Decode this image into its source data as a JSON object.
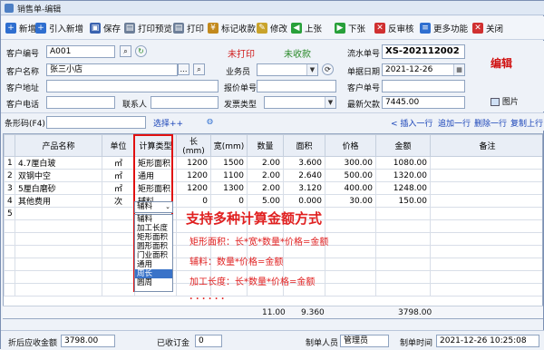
{
  "window": {
    "title": "销售单-编辑"
  },
  "toolbar": [
    {
      "name": "new-button",
      "label": "新增",
      "icon": "plus-icon",
      "color": "#2f6fd0",
      "glyph": "+"
    },
    {
      "name": "import-new-button",
      "label": "引入新增",
      "icon": "import-icon",
      "color": "#2f6fd0",
      "glyph": "+"
    },
    {
      "name": "save-button",
      "label": "保存",
      "icon": "floppy-icon",
      "color": "#3a63b0",
      "glyph": "▣"
    },
    {
      "name": "print-preview-button",
      "label": "打印预览",
      "icon": "print-preview-icon",
      "color": "#6d7f99",
      "glyph": "▤"
    },
    {
      "name": "print-button",
      "label": "打印",
      "icon": "printer-icon",
      "color": "#6d7f99",
      "glyph": "▤"
    },
    {
      "name": "mark-received-button",
      "label": "标记收款",
      "icon": "money-icon",
      "color": "#c38a1d",
      "glyph": "¥"
    },
    {
      "name": "modify-button",
      "label": "修改",
      "icon": "pencil-icon",
      "color": "#c9a32b",
      "glyph": "✎"
    },
    {
      "name": "prev-button",
      "label": "上张",
      "icon": "arrow-left-icon",
      "color": "#28a03a",
      "glyph": "◀"
    },
    {
      "name": "next-button",
      "label": "下张",
      "icon": "arrow-right-icon",
      "color": "#28a03a",
      "glyph": "▶"
    },
    {
      "name": "unaudit-button",
      "label": "反审核",
      "icon": "unaudit-icon",
      "color": "#d03030",
      "glyph": "✕"
    },
    {
      "name": "more-button",
      "label": "更多功能",
      "icon": "more-icon",
      "color": "#2f6fd0",
      "glyph": "≡"
    },
    {
      "name": "close-button",
      "label": "关闭",
      "icon": "close-icon",
      "color": "#d03030",
      "glyph": "✕"
    }
  ],
  "form": {
    "customer_code_label": "客户编号",
    "customer_code": "A001",
    "customer_name_label": "客户名称",
    "customer_name": "张三小店",
    "customer_addr_label": "客户地址",
    "customer_addr": "",
    "customer_phone_label": "客户电话",
    "customer_phone": "",
    "contact_label": "联系人",
    "contact": "",
    "print_status": "未打印",
    "receive_status": "未收款",
    "salesperson_label": "业务员",
    "salesperson": "",
    "quote_no_label": "报价单号",
    "quote_no": "",
    "invoice_type_label": "发票类型",
    "invoice_type": "",
    "serial_label": "流水单号",
    "serial": "XS-202112002",
    "date_label": "单据日期",
    "date": "2021-12-26",
    "customer_doc_label": "客户单号",
    "customer_doc": "",
    "latest_debt_label": "最新欠款",
    "latest_debt": "7445.00",
    "edit_mark": "编辑",
    "image_label": "图片"
  },
  "barcode": {
    "label": "条形码(F4)",
    "value": "",
    "select_label": "选择++",
    "actions": [
      "< 插入一行",
      "追加一行",
      "删除一行",
      "复制上行"
    ]
  },
  "table": {
    "headers": [
      "",
      "产品名称",
      "单位",
      "计算类型",
      "长(mm)",
      "宽(mm)",
      "数量",
      "面积",
      "价格",
      "金额",
      "备注"
    ],
    "rows": [
      [
        "1",
        "4.7厘白玻",
        "㎡",
        "矩形面积",
        "1200",
        "1500",
        "2.00",
        "3.600",
        "300.00",
        "1080.00",
        ""
      ],
      [
        "2",
        "双钢中空",
        "㎡",
        "通用",
        "1200",
        "1100",
        "2.00",
        "2.640",
        "500.00",
        "1320.00",
        ""
      ],
      [
        "3",
        "5厘白磨砂",
        "㎡",
        "矩形面积",
        "1200",
        "1300",
        "2.00",
        "3.120",
        "400.00",
        "1248.00",
        ""
      ],
      [
        "4",
        "其他费用",
        "次",
        "辅料",
        "0",
        "0",
        "5.00",
        "0.000",
        "30.00",
        "150.00",
        ""
      ],
      [
        "5",
        "",
        "",
        "辅料",
        "",
        "",
        "",
        "",
        "",
        "",
        ""
      ]
    ],
    "totals": {
      "qty": "11.00",
      "area": "9.360",
      "amount": "3798.00"
    }
  },
  "dropdown": {
    "current": "辅料",
    "options": [
      "辅料",
      "加工长度",
      "矩形面积",
      "圆形面积",
      "门业面积",
      "通用",
      "周长",
      "圆周"
    ],
    "selected_index": 6
  },
  "promo": {
    "title": "支持多种计算金额方式",
    "lines": [
      "矩形面积：长*宽*数量*价格=金额",
      "辅料：数量*价格=金额",
      "加工长度：长*数量*价格=金额",
      ". . . . . ."
    ]
  },
  "statusbar": {
    "receivable_label": "折后应收金额",
    "receivable": "3798.00",
    "received_label": "已收订金",
    "received": "0",
    "maker_label": "制单人员",
    "maker": "管理员",
    "make_time_label": "制单时间",
    "make_time": "2021-12-26 10:25:08"
  },
  "colors": {
    "accent_red": "#e02020",
    "select_blue": "#3a73c8",
    "status_green": "#2a8a2a"
  }
}
